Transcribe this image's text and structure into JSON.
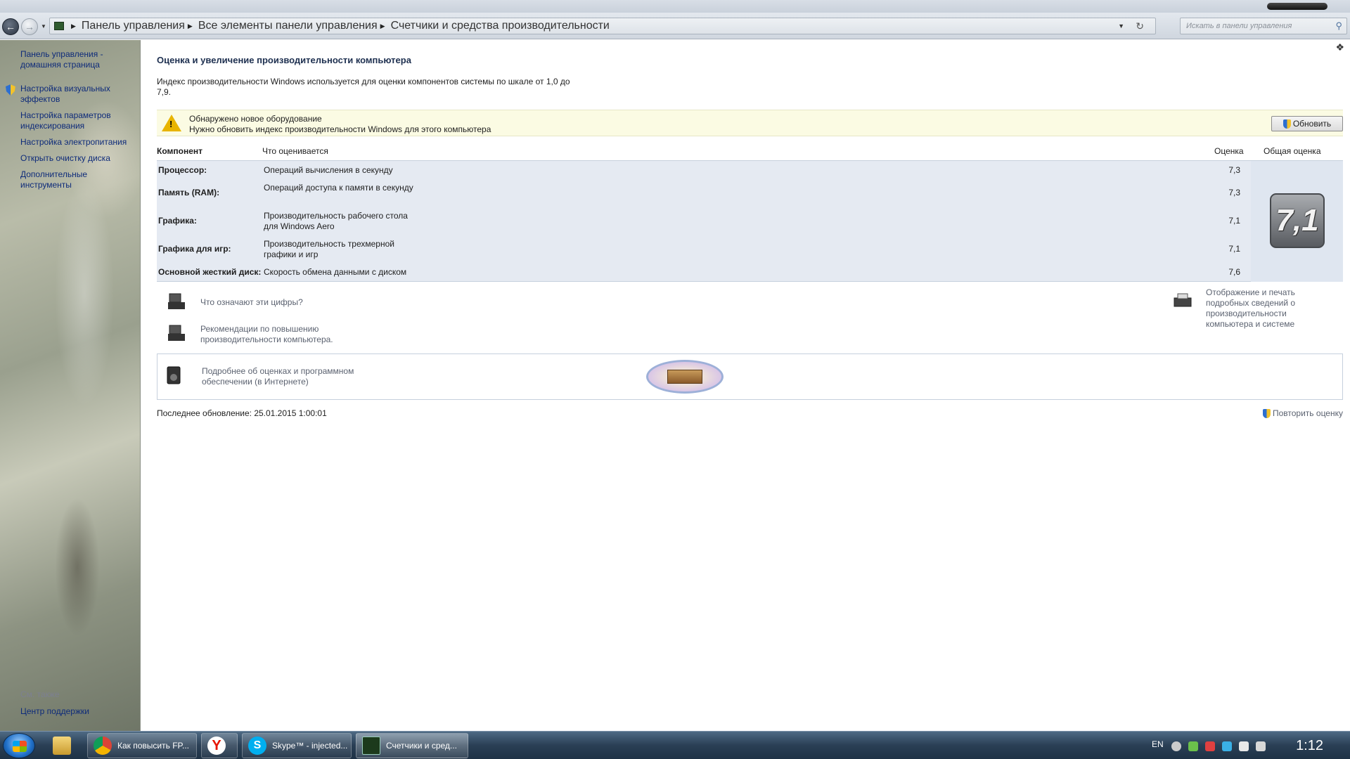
{
  "nav": {
    "breadcrumbs": [
      "Панель управления",
      "Все элементы панели управления",
      "Счетчики и средства производительности"
    ],
    "search_placeholder": "Искать в панели управления"
  },
  "sidebar": {
    "links": [
      "Панель управления - домашняя страница",
      "Настройка визуальных эффектов",
      "Настройка параметров индексирования",
      "Настройка электропитания",
      "Открыть очистку диска",
      "Дополнительные инструменты"
    ],
    "see_also": "См. также",
    "support": "Центр поддержки"
  },
  "main": {
    "title": "Оценка и увеличение производительности компьютера",
    "intro": "Индекс производительности Windows используется для оценки компонентов системы по шкале от 1,0 до 7,9.",
    "warning": {
      "line1": "Обнаружено новое оборудование",
      "line2": "Нужно обновить индекс производительности Windows для этого компьютера",
      "button": "Обновить"
    },
    "table": {
      "headers": {
        "component": "Компонент",
        "what": "Что оценивается",
        "score": "Оценка",
        "overall": "Общая оценка"
      },
      "rows": [
        {
          "name": "Процессор:",
          "what": "Операций вычисления в секунду",
          "score": "7,3"
        },
        {
          "name": "Память (RAM):",
          "what": "Операций доступа к памяти в секунду",
          "score": "7,3"
        },
        {
          "name": "Графика:",
          "what": "Производительность рабочего стола для Windows Aero",
          "score": "7,1"
        },
        {
          "name": "Графика для игр:",
          "what": "Производительность трехмерной графики и игр",
          "score": "7,1"
        },
        {
          "name": "Основной жесткий диск:",
          "what": "Скорость обмена данными с диском",
          "score": "7,6"
        }
      ],
      "overall": "7,1"
    },
    "links": {
      "what_numbers": "Что означают эти цифры?",
      "tips": "Рекомендации по повышению производительности компьютера.",
      "print": "Отображение и печать подробных сведений о производительности компьютера и системе",
      "online": "Подробнее об оценках и программном обеспечении (в Интернете)"
    },
    "last_update": "Последнее обновление: 25.01.2015 1:00:01",
    "repeat": "Повторить оценку"
  },
  "taskbar": {
    "items": [
      "Как повысить FP...",
      "",
      "Skype™ - injected...",
      "Счетчики и сред..."
    ],
    "lang": "EN",
    "clock": "1:12"
  }
}
